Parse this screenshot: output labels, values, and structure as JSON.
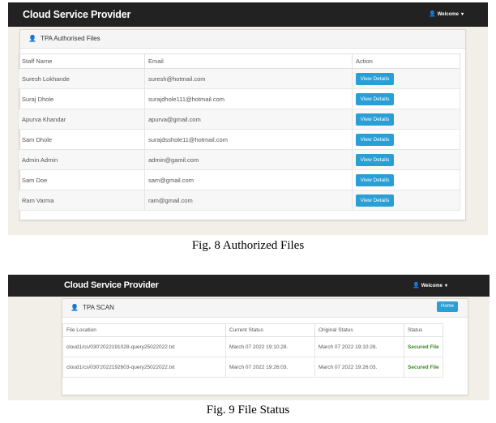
{
  "figure1": {
    "brand": "Cloud Service Provider",
    "welcome": "Welcome",
    "panel_title": "TPA Authorised Files",
    "columns": [
      "Staff Name",
      "Email",
      "Action"
    ],
    "rows": [
      {
        "name": "Suresh Lokhande",
        "email": "suresh@hotmail.com",
        "action": "View Details"
      },
      {
        "name": "Suraj Dhole",
        "email": "surajdhole111@hotmail.com",
        "action": "View Details"
      },
      {
        "name": "Apurva Khandar",
        "email": "apurva@gmail.com",
        "action": "View Details"
      },
      {
        "name": "Sam Dhole",
        "email": "surajdsshole11@hotmail.com",
        "action": "View Details"
      },
      {
        "name": "Admin Admin",
        "email": "admin@gamil.com",
        "action": "View Details"
      },
      {
        "name": "Sam Doe",
        "email": "sam@gmail.com",
        "action": "View Details"
      },
      {
        "name": "Ram Varma",
        "email": "ram@gmail.com",
        "action": "View Details"
      }
    ],
    "caption": "Fig. 8 Authorized Files"
  },
  "figure2": {
    "brand": "Cloud Service Provider",
    "welcome": "Welcome",
    "panel_title": "TPA SCAN",
    "home_label": "Home",
    "columns": [
      "File Location",
      "Current Status",
      "Original Status",
      "Status"
    ],
    "rows": [
      {
        "location": "cloud1/cs/030'2022191028-query25022022.txt",
        "current": "March 07 2022 19:10:28.",
        "original": "March 07 2022 19:10:28.",
        "status": "Secured File"
      },
      {
        "location": "cloud1/cs/030'2022192603-query25022022.txt",
        "current": "March 07 2022 19:26:03.",
        "original": "March 07 2022 19:26:03.",
        "status": "Secured File"
      }
    ],
    "caption": "Fig. 9 File Status"
  },
  "colors": {
    "navbar": "#222222",
    "button": "#2a9fd6",
    "secured": "#3a8a1f"
  }
}
